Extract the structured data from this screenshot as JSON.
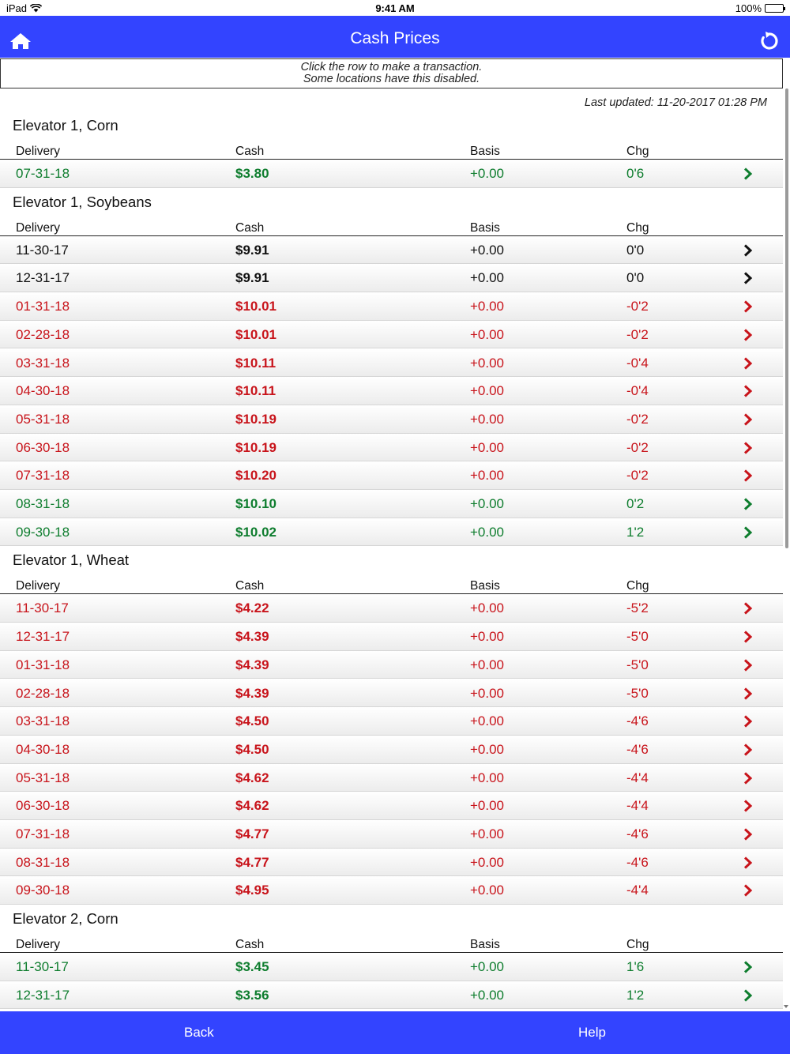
{
  "status_bar": {
    "device": "iPad",
    "time": "9:41 AM",
    "battery": "100%"
  },
  "header": {
    "title": "Cash Prices"
  },
  "notice": {
    "line1": "Click the row to make a transaction.",
    "line2": "Some locations have this disabled."
  },
  "last_updated": "Last updated: 11-20-2017 01:28 PM",
  "columns": {
    "delivery": "Delivery",
    "cash": "Cash",
    "basis": "Basis",
    "chg": "Chg"
  },
  "colors": {
    "green": "#0e7d2e",
    "red": "#c8141b",
    "black": "#111111",
    "brand": "#3344ff"
  },
  "sections": [
    {
      "title": "Elevator 1, Corn",
      "rows": [
        {
          "delivery": "07-31-18",
          "cash": "$3.80",
          "basis": "+0.00",
          "chg": "0'6",
          "trend": "green"
        }
      ]
    },
    {
      "title": "Elevator 1, Soybeans",
      "rows": [
        {
          "delivery": "11-30-17",
          "cash": "$9.91",
          "basis": "+0.00",
          "chg": "0'0",
          "trend": "black"
        },
        {
          "delivery": "12-31-17",
          "cash": "$9.91",
          "basis": "+0.00",
          "chg": "0'0",
          "trend": "black"
        },
        {
          "delivery": "01-31-18",
          "cash": "$10.01",
          "basis": "+0.00",
          "chg": "-0'2",
          "trend": "red"
        },
        {
          "delivery": "02-28-18",
          "cash": "$10.01",
          "basis": "+0.00",
          "chg": "-0'2",
          "trend": "red"
        },
        {
          "delivery": "03-31-18",
          "cash": "$10.11",
          "basis": "+0.00",
          "chg": "-0'4",
          "trend": "red"
        },
        {
          "delivery": "04-30-18",
          "cash": "$10.11",
          "basis": "+0.00",
          "chg": "-0'4",
          "trend": "red"
        },
        {
          "delivery": "05-31-18",
          "cash": "$10.19",
          "basis": "+0.00",
          "chg": "-0'2",
          "trend": "red"
        },
        {
          "delivery": "06-30-18",
          "cash": "$10.19",
          "basis": "+0.00",
          "chg": "-0'2",
          "trend": "red"
        },
        {
          "delivery": "07-31-18",
          "cash": "$10.20",
          "basis": "+0.00",
          "chg": "-0'2",
          "trend": "red"
        },
        {
          "delivery": "08-31-18",
          "cash": "$10.10",
          "basis": "+0.00",
          "chg": "0'2",
          "trend": "green"
        },
        {
          "delivery": "09-30-18",
          "cash": "$10.02",
          "basis": "+0.00",
          "chg": "1'2",
          "trend": "green"
        }
      ]
    },
    {
      "title": "Elevator 1, Wheat",
      "rows": [
        {
          "delivery": "11-30-17",
          "cash": "$4.22",
          "basis": "+0.00",
          "chg": "-5'2",
          "trend": "red"
        },
        {
          "delivery": "12-31-17",
          "cash": "$4.39",
          "basis": "+0.00",
          "chg": "-5'0",
          "trend": "red"
        },
        {
          "delivery": "01-31-18",
          "cash": "$4.39",
          "basis": "+0.00",
          "chg": "-5'0",
          "trend": "red"
        },
        {
          "delivery": "02-28-18",
          "cash": "$4.39",
          "basis": "+0.00",
          "chg": "-5'0",
          "trend": "red"
        },
        {
          "delivery": "03-31-18",
          "cash": "$4.50",
          "basis": "+0.00",
          "chg": "-4'6",
          "trend": "red"
        },
        {
          "delivery": "04-30-18",
          "cash": "$4.50",
          "basis": "+0.00",
          "chg": "-4'6",
          "trend": "red"
        },
        {
          "delivery": "05-31-18",
          "cash": "$4.62",
          "basis": "+0.00",
          "chg": "-4'4",
          "trend": "red"
        },
        {
          "delivery": "06-30-18",
          "cash": "$4.62",
          "basis": "+0.00",
          "chg": "-4'4",
          "trend": "red"
        },
        {
          "delivery": "07-31-18",
          "cash": "$4.77",
          "basis": "+0.00",
          "chg": "-4'6",
          "trend": "red"
        },
        {
          "delivery": "08-31-18",
          "cash": "$4.77",
          "basis": "+0.00",
          "chg": "-4'6",
          "trend": "red"
        },
        {
          "delivery": "09-30-18",
          "cash": "$4.95",
          "basis": "+0.00",
          "chg": "-4'4",
          "trend": "red"
        }
      ]
    },
    {
      "title": "Elevator 2, Corn",
      "rows": [
        {
          "delivery": "11-30-17",
          "cash": "$3.45",
          "basis": "+0.00",
          "chg": "1'6",
          "trend": "green"
        },
        {
          "delivery": "12-31-17",
          "cash": "$3.56",
          "basis": "+0.00",
          "chg": "1'2",
          "trend": "green"
        }
      ]
    }
  ],
  "footer": {
    "back_label": "Back",
    "help_label": "Help"
  }
}
